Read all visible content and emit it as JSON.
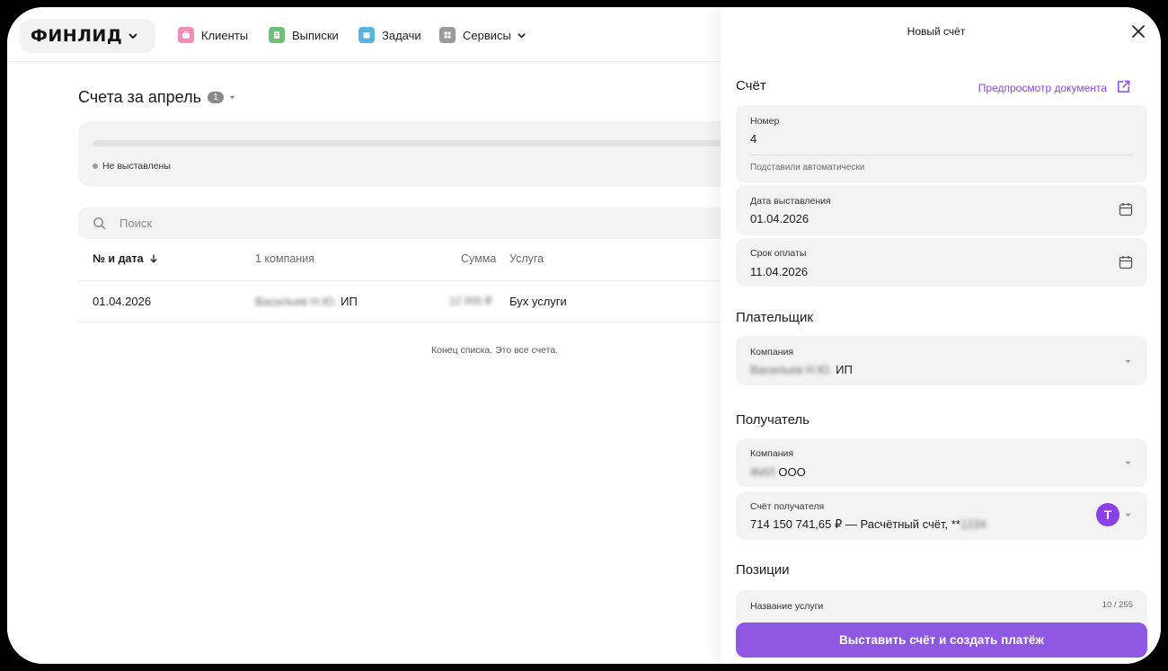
{
  "nav": {
    "logo": "ФИНЛИД",
    "items": [
      {
        "label": "Клиенты",
        "icon": "briefcase-icon",
        "color": "#f08fb6"
      },
      {
        "label": "Выписки",
        "icon": "document-icon",
        "color": "#6cc07a"
      },
      {
        "label": "Задачи",
        "icon": "tasks-icon",
        "color": "#57b4de"
      },
      {
        "label": "Сервисы",
        "icon": "grid-icon",
        "color": "#9a9a9a"
      }
    ]
  },
  "main": {
    "title": "Счета за апрель",
    "count": "1",
    "legend": "Не выставлены",
    "search_placeholder": "Поиск",
    "columns": {
      "number_date": "№ и дата",
      "companies": "1 компания",
      "sum": "Сумма",
      "service": "Услуга"
    },
    "rows": [
      {
        "date": "01.04.2026",
        "company_blurred": "Васильев Н.Ю.",
        "company_suffix": "ИП",
        "sum": "12 000 ₽",
        "service": "Бух услуги"
      }
    ],
    "end_note": "Конец списка. Это все счета."
  },
  "panel": {
    "title": "Новый счёт",
    "sections": {
      "invoice": "Счёт",
      "payer": "Плательщик",
      "recipient": "Получатель",
      "positions": "Позиции"
    },
    "preview_link": "Предпросмотр документа",
    "number": {
      "label": "Номер",
      "value": "4",
      "hint": "Подставили автоматически"
    },
    "issue_date": {
      "label": "Дата выставления",
      "value": "01.04.2026"
    },
    "due_date": {
      "label": "Срок оплаты",
      "value": "11.04.2026"
    },
    "payer_company": {
      "label": "Компания",
      "blurred": "Васильев Н.Ю.",
      "suffix": "ИП"
    },
    "recipient_company": {
      "label": "Компания",
      "blurred": "ФИЛ",
      "suffix": "ООО"
    },
    "recipient_account": {
      "label": "Счёт получателя",
      "value": "714 150 741,65 ₽ — Расчётный счёт, **",
      "blurred": "1234",
      "bank_letter": "Т"
    },
    "service_name": {
      "label": "Название услуги",
      "counter": "10 / 255"
    },
    "submit": "Выставить счёт и создать платёж"
  },
  "colors": {
    "accent": "#8f58e3",
    "link": "#8a4bd9",
    "bank": "#8b3fe6"
  }
}
